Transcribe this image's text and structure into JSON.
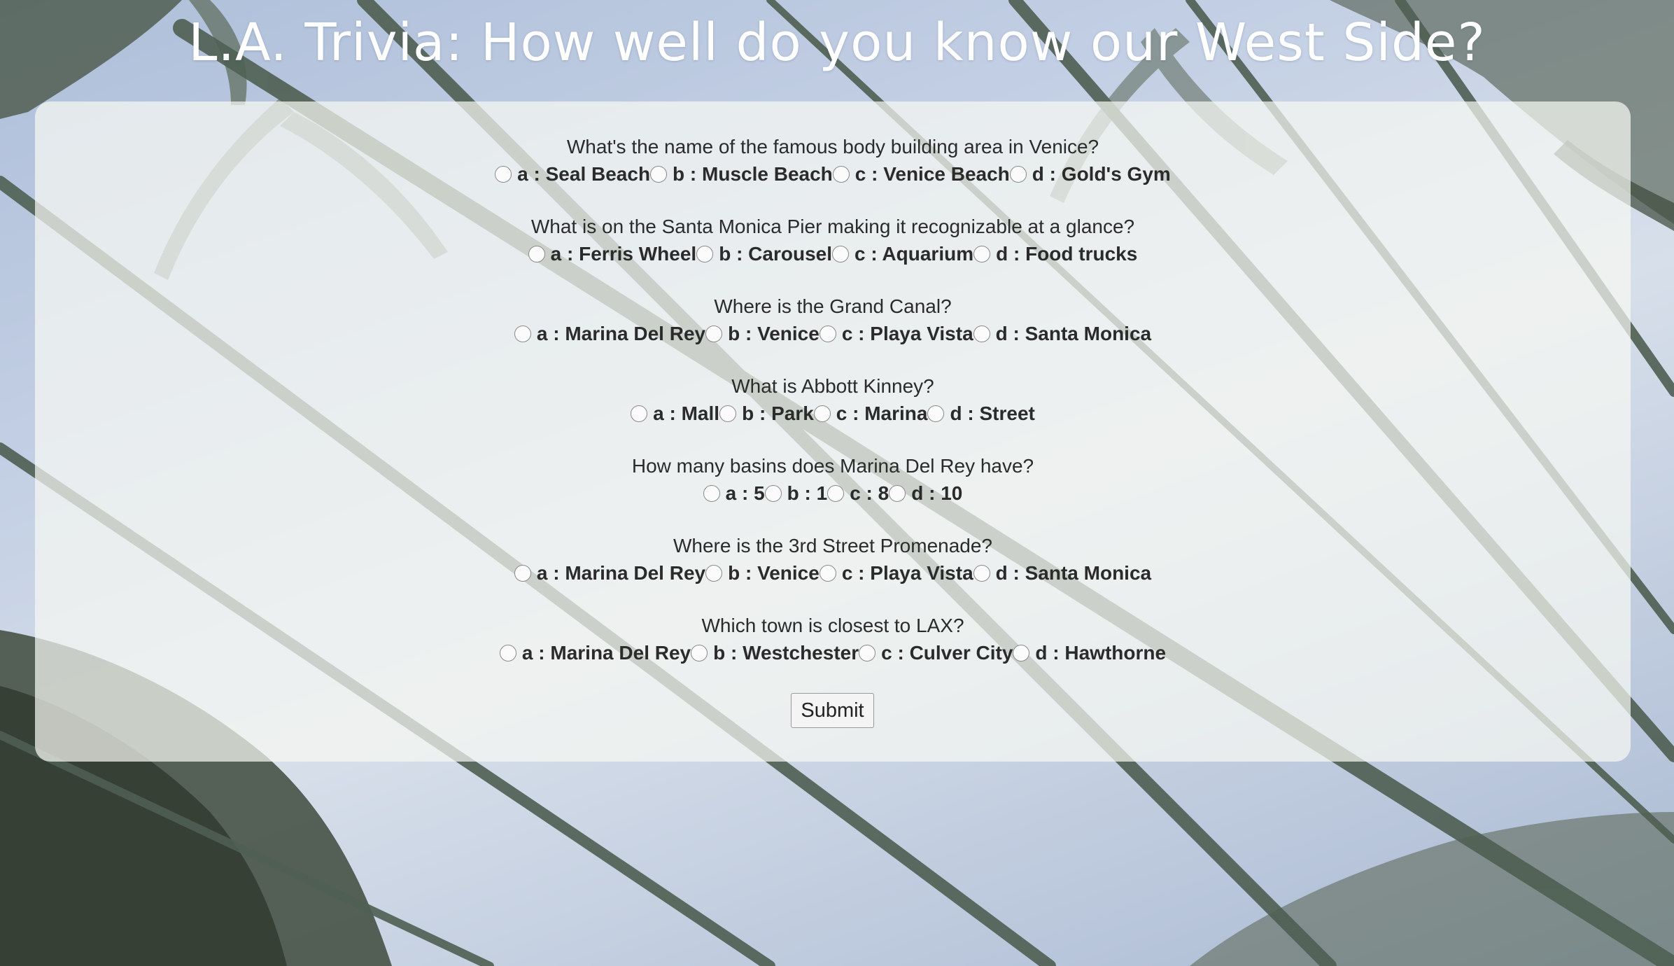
{
  "page": {
    "title": "L.A. Trivia: How well do you know our West Side?"
  },
  "quiz": {
    "questions": [
      {
        "text": "What's the name of the famous body building area in Venice?",
        "options": [
          "a : Seal Beach",
          "b : Muscle Beach",
          "c : Venice Beach",
          "d : Gold's Gym"
        ]
      },
      {
        "text": "What is on the Santa Monica Pier making it recognizable at a glance?",
        "options": [
          "a : Ferris Wheel",
          "b : Carousel",
          "c : Aquarium",
          "d : Food trucks"
        ]
      },
      {
        "text": "Where is the Grand Canal?",
        "options": [
          "a : Marina Del Rey",
          "b : Venice",
          "c : Playa Vista",
          "d : Santa Monica"
        ]
      },
      {
        "text": "What is Abbott Kinney?",
        "options": [
          "a : Mall",
          "b : Park",
          "c : Marina",
          "d : Street"
        ]
      },
      {
        "text": "How many basins does Marina Del Rey have?",
        "options": [
          "a : 5",
          "b : 1",
          "c : 8",
          "d : 10"
        ]
      },
      {
        "text": "Where is the 3rd Street Promenade?",
        "options": [
          "a : Marina Del Rey",
          "b : Venice",
          "c : Playa Vista",
          "d : Santa Monica"
        ]
      },
      {
        "text": "Which town is closest to LAX?",
        "options": [
          "a : Marina Del Rey",
          "b : Westchester",
          "c : Culver City",
          "d : Hawthorne"
        ]
      }
    ],
    "submit_label": "Submit"
  },
  "colors": {
    "sky": "#c3cfe4",
    "palm_trunk": "#4f5f52",
    "panel": "#f7f8f3",
    "title": "#ffffff",
    "text": "#2b2b2b"
  }
}
